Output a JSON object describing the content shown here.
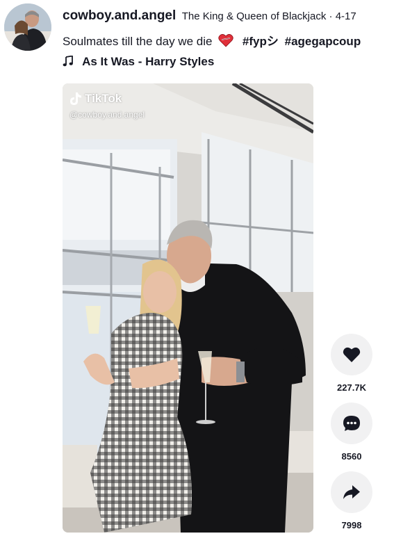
{
  "post": {
    "author": {
      "username": "cowboy.and.angel",
      "nickname": "The King & Queen of Blackjack",
      "date_separator": " · ",
      "date": "4-17"
    },
    "caption": {
      "text": "Soulmates till the day we die",
      "emoji": "heart-with-wound",
      "hashtags": [
        "#fypシ",
        "#agegapcoup"
      ]
    },
    "music": {
      "icon": "music-note-icon",
      "title": "As It Was - Harry Styles"
    },
    "video": {
      "watermark_logo": "TikTok",
      "watermark_handle": "@cowboy.and.angel"
    }
  },
  "actions": {
    "like": {
      "icon": "heart-icon",
      "count": "227.7K"
    },
    "comment": {
      "icon": "comment-icon",
      "count": "8560"
    },
    "share": {
      "icon": "share-icon",
      "count": "7998"
    }
  },
  "colors": {
    "text": "#161823",
    "action_bg": "#f1f1f2",
    "emoji_heart": "#e0303a"
  }
}
